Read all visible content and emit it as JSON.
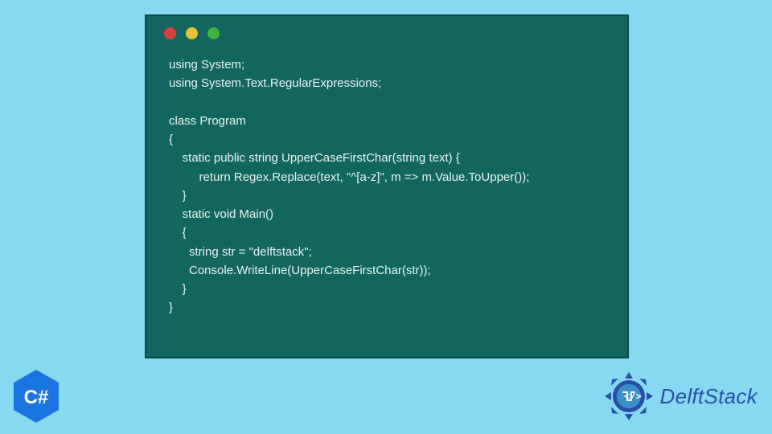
{
  "code": {
    "lines": [
      "using System;",
      "using System.Text.RegularExpressions;",
      "",
      "class Program",
      "{",
      "    static public string UpperCaseFirstChar(string text) {",
      "         return Regex.Replace(text, \"^[a-z]\", m => m.Value.ToUpper());",
      "    }",
      "    static void Main()",
      "    {",
      "      string str = \"delftstack\";",
      "      Console.WriteLine(UpperCaseFirstChar(str));",
      "    }",
      "}"
    ]
  },
  "badge": {
    "label": "C#"
  },
  "brand": {
    "name": "DelftStack"
  },
  "colors": {
    "page_bg": "#87d9f2",
    "window_bg": "#13665f",
    "window_border": "#0d4a44",
    "code_text": "#e6f4f3",
    "red": "#d93f3f",
    "yellow": "#e8c23a",
    "green": "#3fb23f",
    "brand_blue": "#2a4fa8",
    "badge_blue": "#1b75e0"
  }
}
